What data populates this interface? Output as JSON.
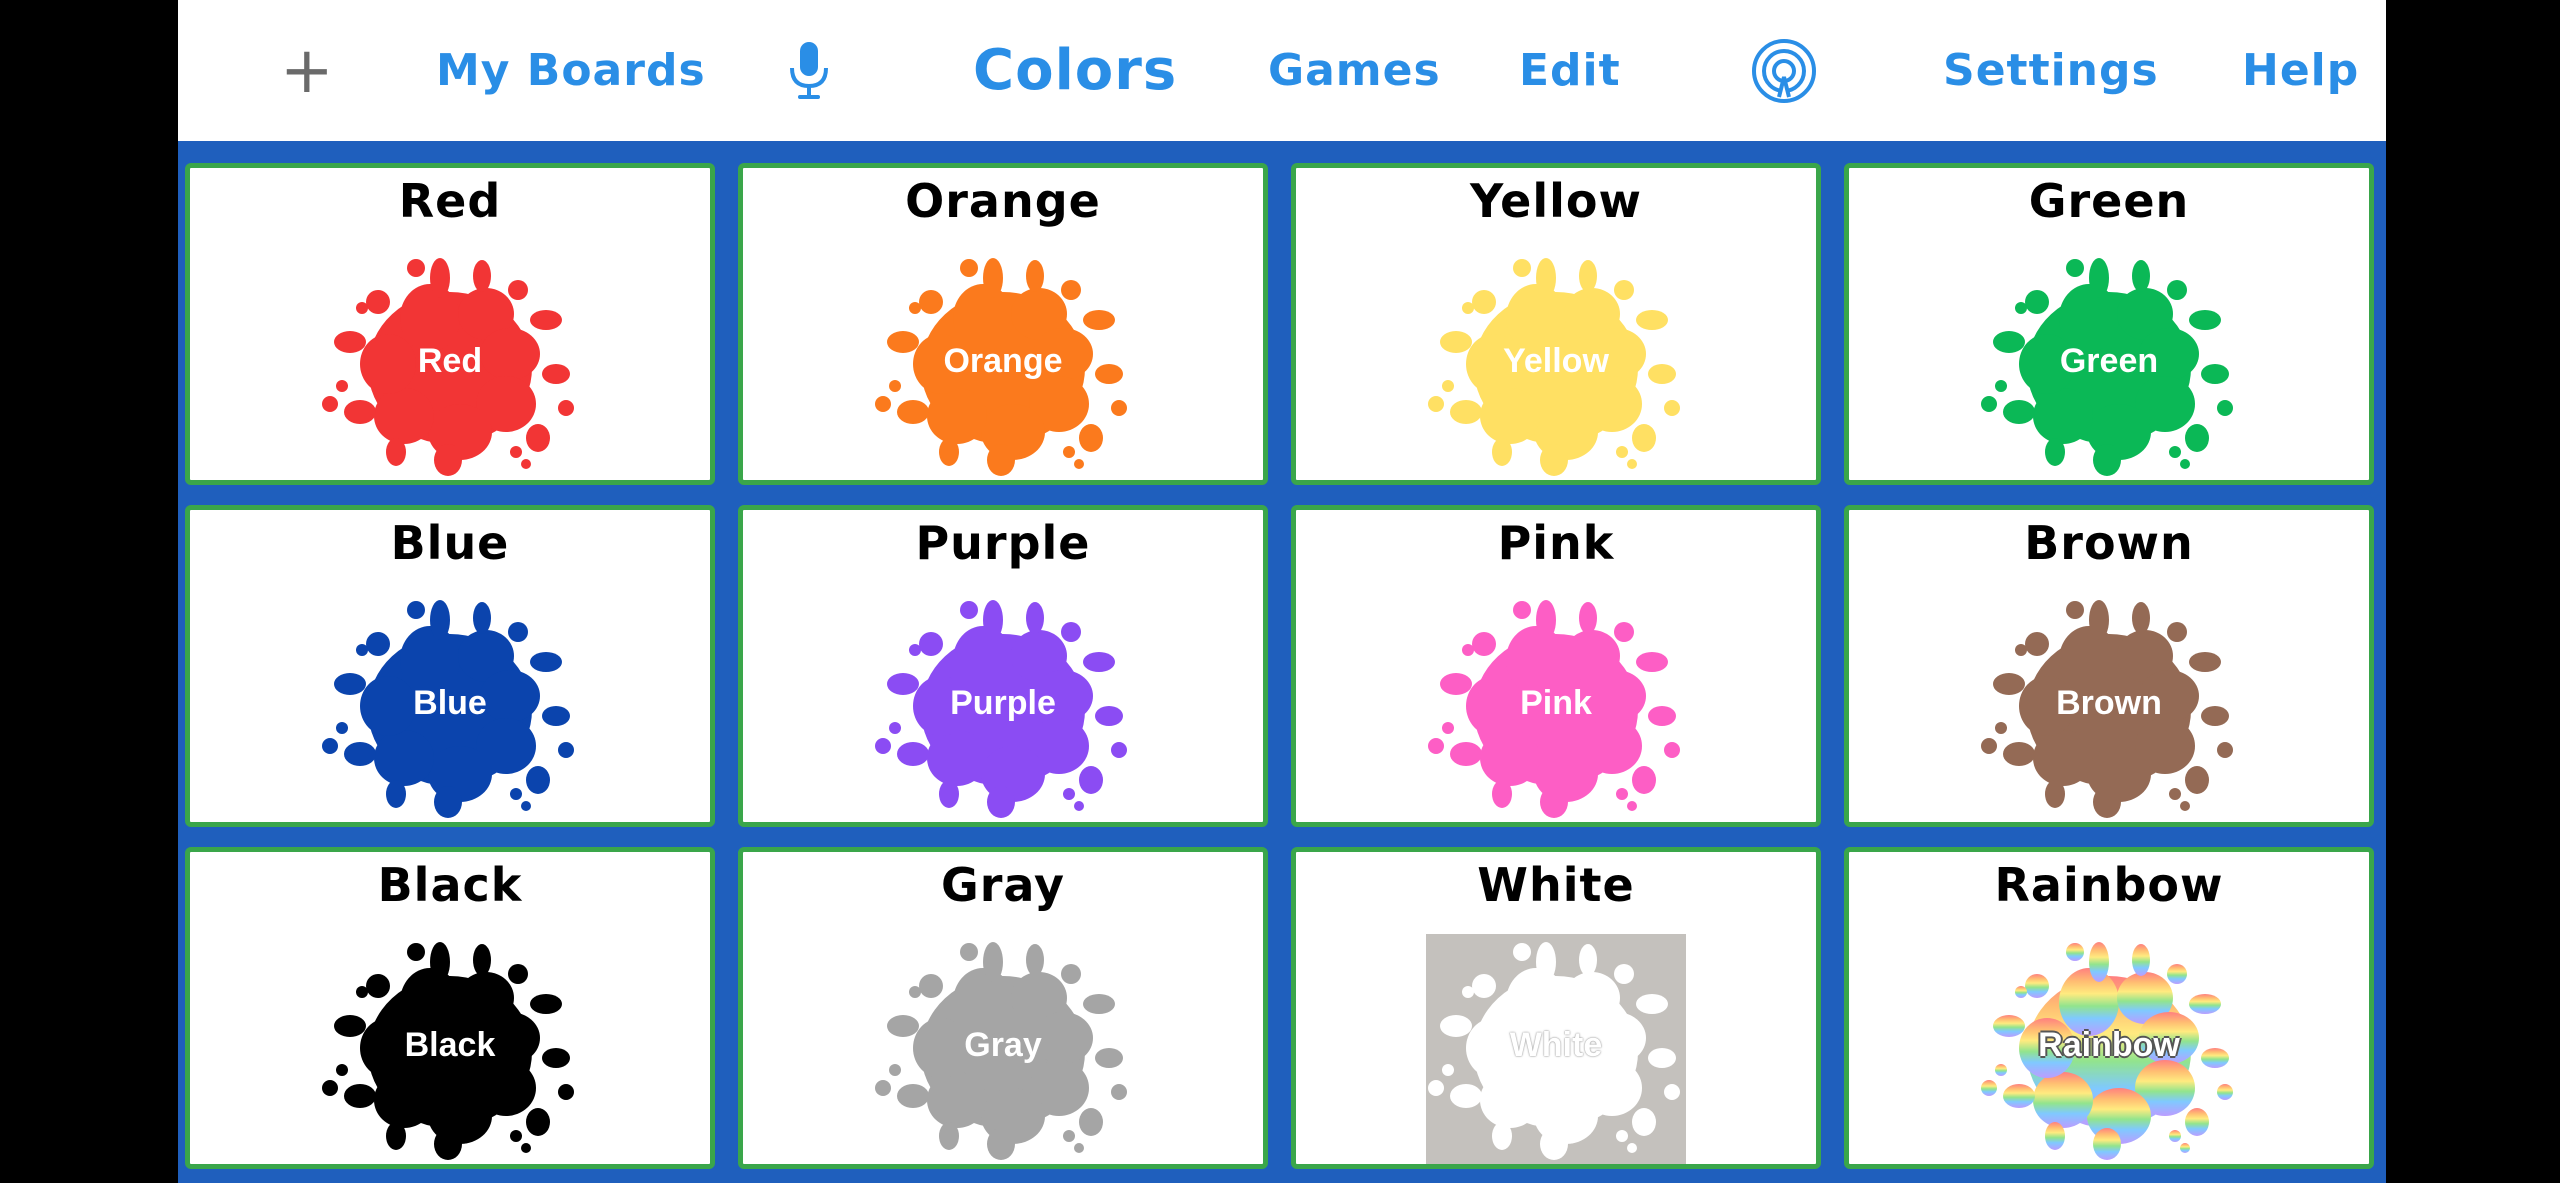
{
  "topbar": {
    "add_label": "+",
    "my_boards": "My Boards",
    "title": "Colors",
    "games": "Games",
    "edit": "Edit",
    "settings": "Settings",
    "help": "Help",
    "icons": {
      "add": "plus-icon",
      "microphone": "microphone-icon",
      "broadcast": "broadcast-icon"
    }
  },
  "colors": {
    "accent": "#2a8ee6",
    "board_background": "#1f5fbd",
    "tile_border": "#3aa64a"
  },
  "tiles": [
    {
      "label": "Red",
      "splat_text": "Red",
      "color": "#f23535"
    },
    {
      "label": "Orange",
      "splat_text": "Orange",
      "color": "#fb7a1d"
    },
    {
      "label": "Yellow",
      "splat_text": "Yellow",
      "color": "#ffe063"
    },
    {
      "label": "Green",
      "splat_text": "Green",
      "color": "#0bb856"
    },
    {
      "label": "Blue",
      "splat_text": "Blue",
      "color": "#0b44ad"
    },
    {
      "label": "Purple",
      "splat_text": "Purple",
      "color": "#8b4cf3"
    },
    {
      "label": "Pink",
      "splat_text": "Pink",
      "color": "#fd5ec5"
    },
    {
      "label": "Brown",
      "splat_text": "Brown",
      "color": "#946a55"
    },
    {
      "label": "Black",
      "splat_text": "Black",
      "color": "#000000"
    },
    {
      "label": "Gray",
      "splat_text": "Gray",
      "color": "#a5a5a5"
    },
    {
      "label": "White",
      "splat_text": "White",
      "color": "#ffffff"
    },
    {
      "label": "Rainbow",
      "splat_text": "Rainbow",
      "color": "rainbow"
    }
  ]
}
